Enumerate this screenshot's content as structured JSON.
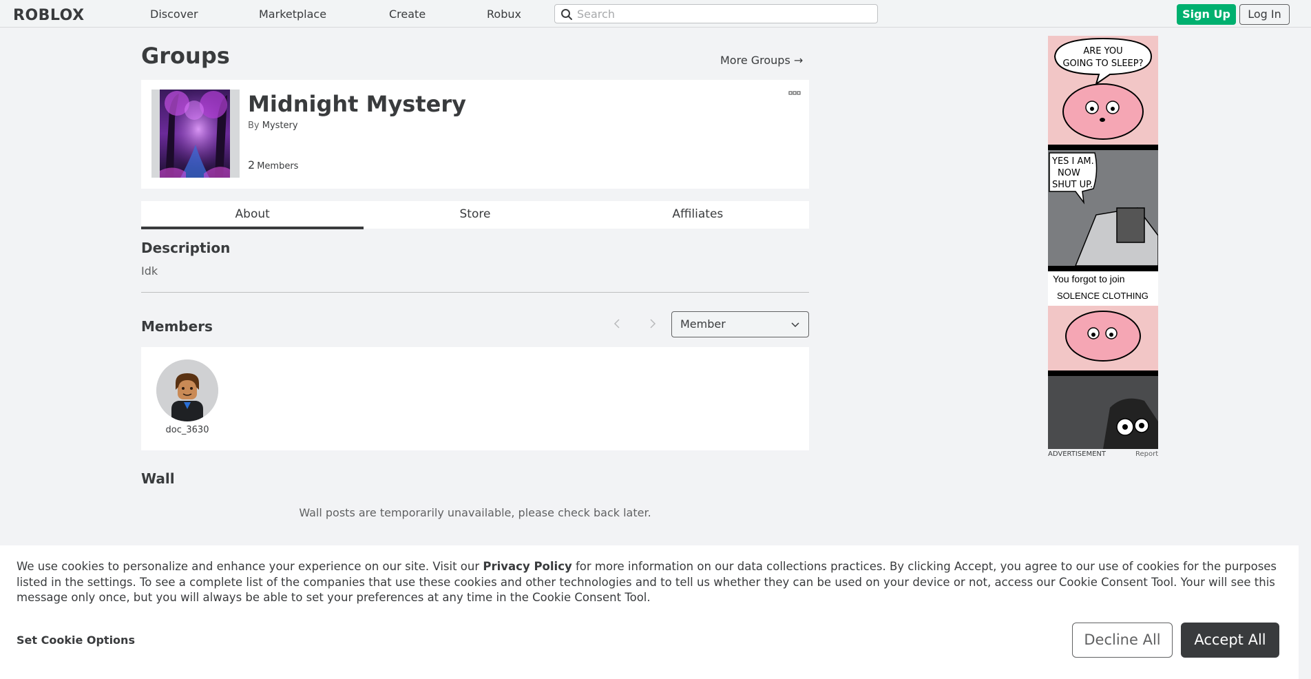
{
  "nav": {
    "logo": "ROBLOX",
    "links": [
      "Discover",
      "Marketplace",
      "Create",
      "Robux"
    ],
    "search_placeholder": "Search",
    "signup": "Sign Up",
    "login": "Log In"
  },
  "page": {
    "title": "Groups",
    "more_groups": "More Groups →"
  },
  "group": {
    "name": "Midnight Mystery",
    "by_prefix": "By",
    "owner": "Mystery",
    "member_count": "2",
    "member_label": "Members"
  },
  "tabs": [
    "About",
    "Store",
    "Affiliates"
  ],
  "description": {
    "heading": "Description",
    "text": "Idk"
  },
  "members": {
    "heading": "Members",
    "role_selected": "Member",
    "list": [
      {
        "name": "doc_3630"
      }
    ]
  },
  "wall": {
    "heading": "Wall",
    "message": "Wall posts are temporarily unavailable, please check back later."
  },
  "ad": {
    "panel1": "ARE YOU GOING TO SLEEP?",
    "panel2": "YES I AM. NOW SHUT UP.",
    "panel3_line1": "You forgot to join",
    "panel3_line2": "SOLENCE CLOTHING",
    "label": "ADVERTISEMENT",
    "report": "Report"
  },
  "cookie": {
    "text_before": "We use cookies to personalize and enhance your experience on our site. Visit our ",
    "privacy_link": "Privacy Policy",
    "text_after": " for more information on our data collections practices. By clicking Accept, you agree to our use of cookies for the purposes listed in the settings. To see a complete list of the companies that use these cookies and other technologies and to tell us whether they can be used on your device or not, access our Cookie Consent Tool. Your will see this message only once, but you will always be able to set your preferences at any time in the Cookie Consent Tool.",
    "set_options": "Set Cookie Options",
    "decline": "Decline All",
    "accept": "Accept All"
  }
}
